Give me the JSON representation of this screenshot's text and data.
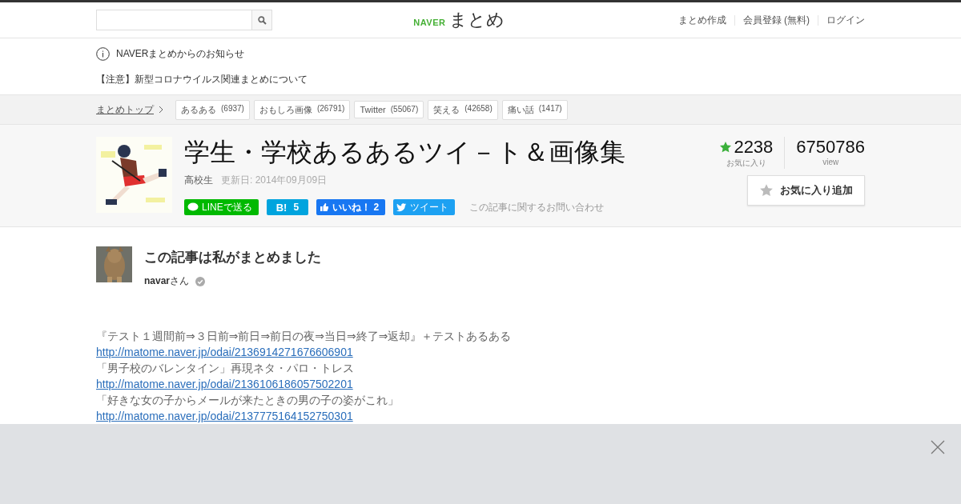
{
  "header": {
    "logo": {
      "brand": "NAVER",
      "name": "まとめ"
    },
    "nav": [
      "まとめ作成",
      "会員登録 (無料)",
      "ログイン"
    ]
  },
  "notice": {
    "title": "NAVERまとめからのお知らせ",
    "items": [
      "【注意】新型コロナウイルス関連まとめについて"
    ]
  },
  "breadcrumb": {
    "home": "まとめトップ",
    "tags": [
      {
        "label": "あるある",
        "count": "(6937)"
      },
      {
        "label": "おもしろ画像",
        "count": "(26791)"
      },
      {
        "label": "Twitter",
        "count": "(55067)"
      },
      {
        "label": "笑える",
        "count": "(42658)"
      },
      {
        "label": "痛い話",
        "count": "(1417)"
      }
    ]
  },
  "article": {
    "title": "学生・学校あるあるツイ－ト＆画像集",
    "category": "高校生",
    "updated": "更新日: 2014年09月09日",
    "share": [
      {
        "kind": "line",
        "label": "LINEで送る"
      },
      {
        "kind": "hatena",
        "mark": "B!",
        "label": "5"
      },
      {
        "kind": "facebook",
        "label": "いいね！ 2"
      },
      {
        "kind": "twitter",
        "label": "ツイート"
      }
    ],
    "contact": "この記事に関するお問い合わせ",
    "favorites": {
      "count": "2238",
      "label": "お気に入り"
    },
    "views": {
      "count": "6750786",
      "label": "view"
    },
    "favorite_button": "お気に入り追加"
  },
  "author": {
    "heading": "この記事は私がまとめました",
    "name": "navar",
    "suffix": "さん",
    "verified": true
  },
  "body": [
    {
      "kind": "text",
      "text": "『テスト１週間前⇒３日前⇒前日⇒前日の夜⇒当日⇒終了⇒返却』＋テストあるある"
    },
    {
      "kind": "link",
      "text": "http://matome.naver.jp/odai/2136914271676606901"
    },
    {
      "kind": "text",
      "text": "「男子校のバレンタイン」再現ネタ・パロ・トレス"
    },
    {
      "kind": "link",
      "text": "http://matome.naver.jp/odai/2136106186057502201"
    },
    {
      "kind": "text",
      "text": "「好きな女の子からメールが来たときの男の子の姿がこれ」"
    },
    {
      "kind": "link",
      "text": "http://matome.naver.jp/odai/2137775164152750301"
    }
  ]
}
